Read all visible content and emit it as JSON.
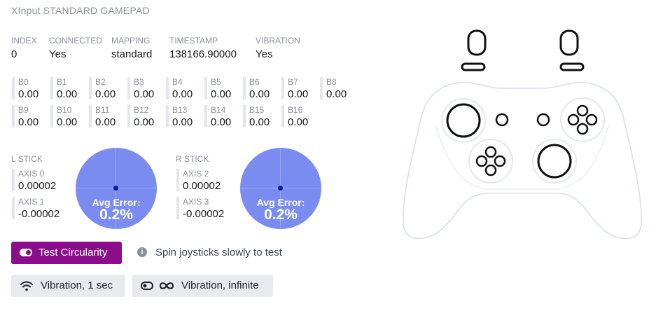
{
  "gamepad": {
    "title": "XInput STANDARD GAMEPAD"
  },
  "info": [
    {
      "label": "INDEX",
      "value": "0"
    },
    {
      "label": "CONNECTED",
      "value": "Yes"
    },
    {
      "label": "MAPPING",
      "value": "standard"
    },
    {
      "label": "TIMESTAMP",
      "value": "138166.90000"
    },
    {
      "label": "VIBRATION",
      "value": "Yes"
    }
  ],
  "buttons": [
    {
      "label": "B0",
      "value": "0.00"
    },
    {
      "label": "B1",
      "value": "0.00"
    },
    {
      "label": "B2",
      "value": "0.00"
    },
    {
      "label": "B3",
      "value": "0.00"
    },
    {
      "label": "B4",
      "value": "0.00"
    },
    {
      "label": "B5",
      "value": "0.00"
    },
    {
      "label": "B6",
      "value": "0.00"
    },
    {
      "label": "B7",
      "value": "0.00"
    },
    {
      "label": "B8",
      "value": "0.00"
    },
    {
      "label": "B9",
      "value": "0.00"
    },
    {
      "label": "B10",
      "value": "0.00"
    },
    {
      "label": "B11",
      "value": "0.00"
    },
    {
      "label": "B12",
      "value": "0.00"
    },
    {
      "label": "B13",
      "value": "0.00"
    },
    {
      "label": "B14",
      "value": "0.00"
    },
    {
      "label": "B15",
      "value": "0.00"
    },
    {
      "label": "B16",
      "value": "0.00"
    }
  ],
  "left_stick": {
    "label": "L STICK",
    "axes": [
      {
        "label": "AXIS 0",
        "value": "0.00002"
      },
      {
        "label": "AXIS 1",
        "value": "-0.00002"
      }
    ],
    "error_label": "Avg Error:",
    "error_value": "0.2%"
  },
  "right_stick": {
    "label": "R STICK",
    "axes": [
      {
        "label": "AXIS 2",
        "value": "0.00002"
      },
      {
        "label": "AXIS 3",
        "value": "-0.00002"
      }
    ],
    "error_label": "Avg Error:",
    "error_value": "0.2%"
  },
  "actions": {
    "test_circularity": "Test Circularity",
    "hint": "Spin joysticks slowly to test",
    "vibration_1sec": "Vibration, 1 sec",
    "vibration_infinite": "Vibration, infinite"
  },
  "colors": {
    "accent": "#8b0d8b",
    "circle_fill": "#7b8cf0",
    "stick_dot": "#0a1a9e",
    "controller_outline": "#dde2ea"
  }
}
